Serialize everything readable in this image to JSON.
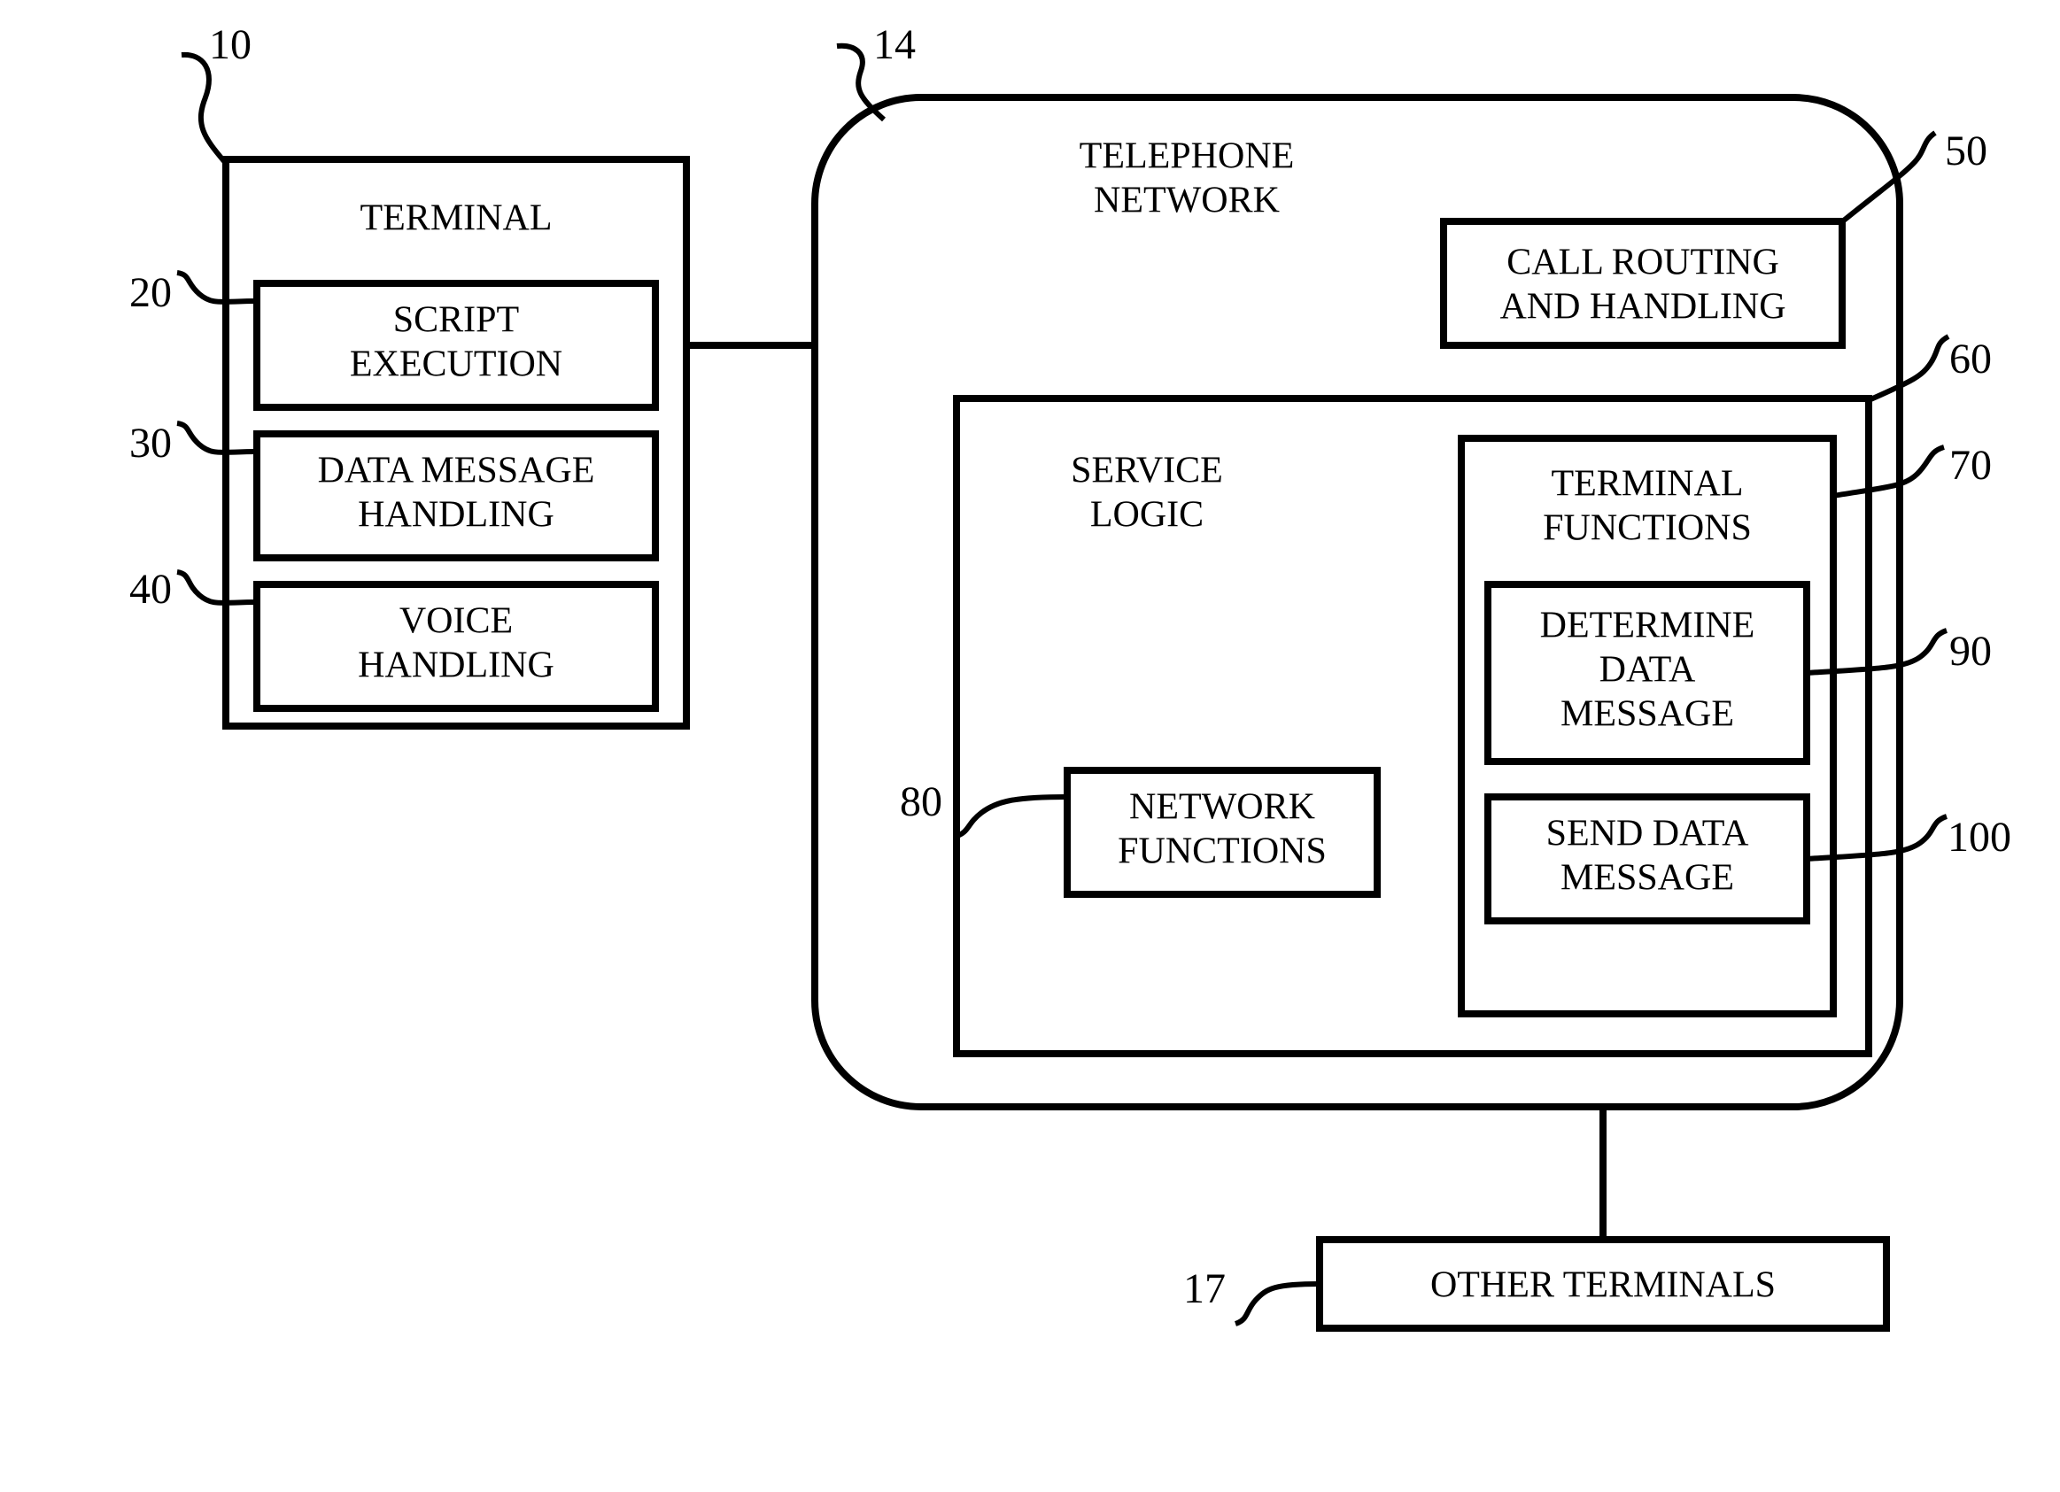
{
  "blocks": {
    "terminal": {
      "title": "TERMINAL",
      "ref": "10"
    },
    "script_exec": {
      "title": "SCRIPT EXECUTION",
      "ref": "20"
    },
    "data_msg_handling": {
      "title": "DATA MESSAGE HANDLING",
      "ref": "30"
    },
    "voice_handling": {
      "title": "VOICE HANDLING",
      "ref": "40"
    },
    "telephone_network": {
      "title": "TELEPHONE NETWORK",
      "ref": "14"
    },
    "call_routing": {
      "title": "CALL ROUTING AND HANDLING",
      "ref": "50"
    },
    "service_logic": {
      "title": "SERVICE LOGIC",
      "ref": "60"
    },
    "network_functions": {
      "title": "NETWORK FUNCTIONS",
      "ref": "80"
    },
    "terminal_functions": {
      "title": "TERMINAL FUNCTIONS",
      "ref": "70"
    },
    "determine_data": {
      "title": "DETERMINE DATA MESSAGE",
      "ref": "90"
    },
    "send_data": {
      "title": "SEND DATA MESSAGE",
      "ref": "100"
    },
    "other_terminals": {
      "title": "OTHER TERMINALS",
      "ref": "17"
    }
  }
}
